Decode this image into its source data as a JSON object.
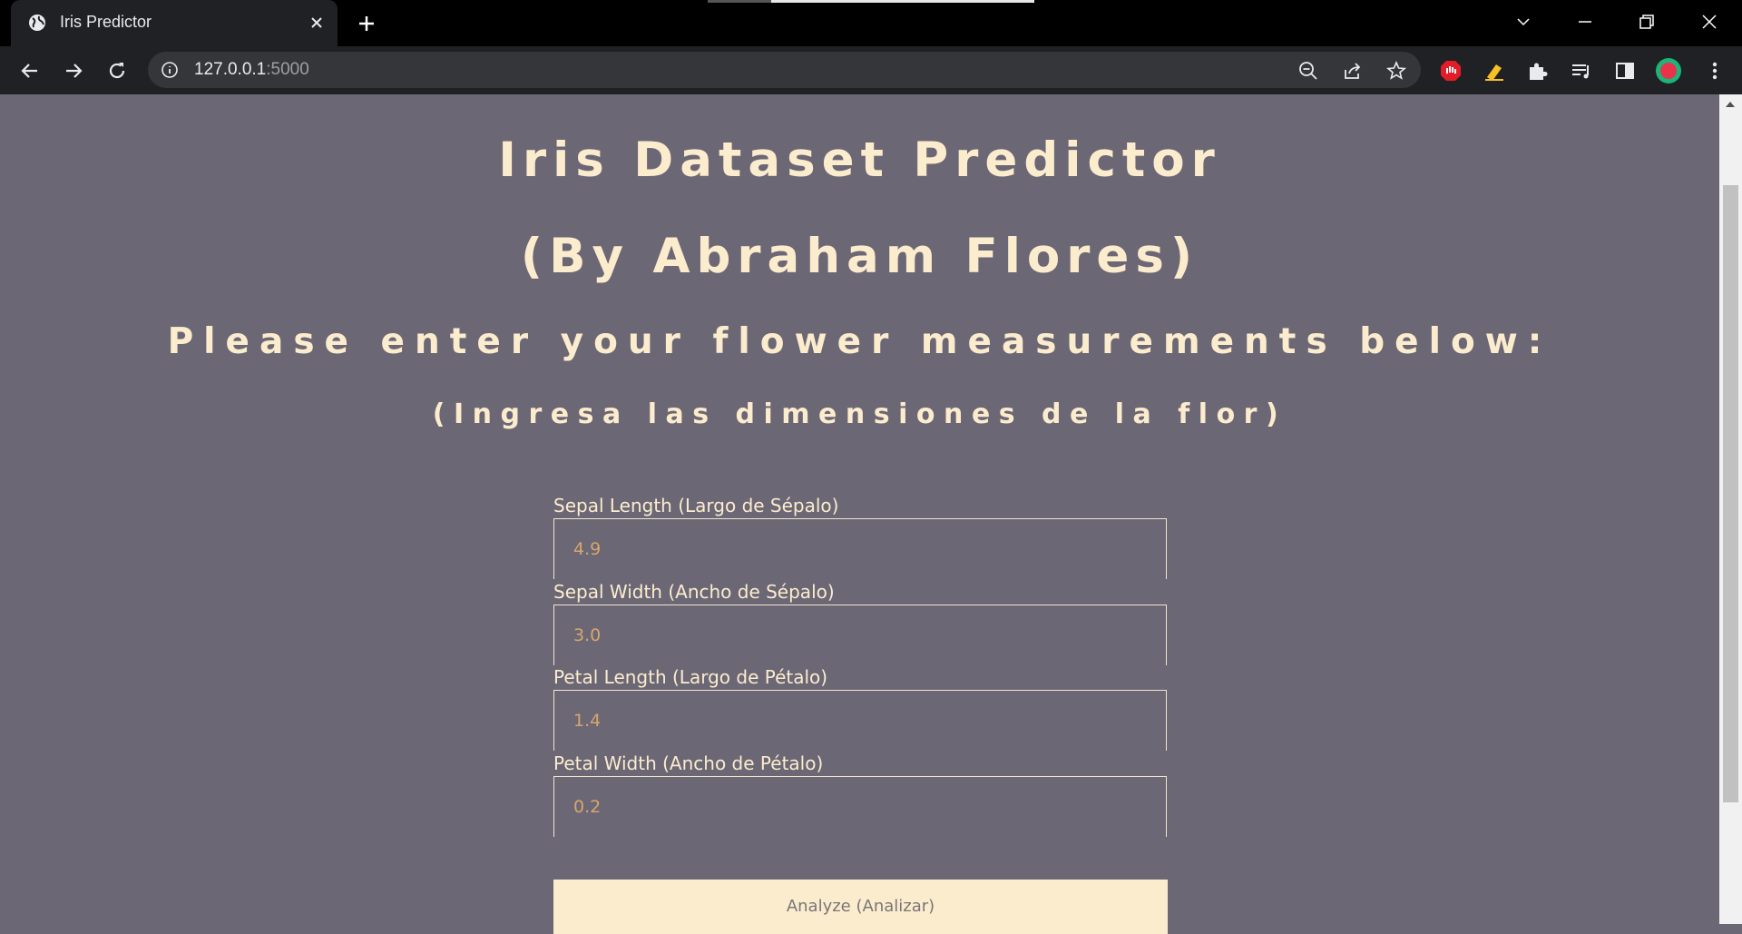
{
  "browser": {
    "tab_title": "Iris Predictor",
    "url_host": "127.0.0.1",
    "url_port": ":5000",
    "icons": {
      "favicon": "globe-icon",
      "close": "close-icon",
      "new_tab": "plus-icon",
      "back": "arrow-left-icon",
      "forward": "arrow-right-icon",
      "reload": "reload-icon",
      "info": "info-icon",
      "zoom": "zoom-out-icon",
      "share": "share-icon",
      "bookmark": "star-icon",
      "extensions": [
        "adblock-icon",
        "highlighter-icon",
        "puzzle-icon",
        "media-control-icon",
        "side-panel-icon"
      ],
      "menu": "kebab-icon"
    }
  },
  "page": {
    "title_line1": "Iris Dataset Predictor",
    "title_line2": "(By Abraham Flores)",
    "subtitle": "Please enter your flower measurements below:",
    "subtitle_es": "(Ingresa las dimensiones de la flor)",
    "fields": [
      {
        "label": "Sepal Length (Largo de Sépalo)",
        "placeholder": "4.9"
      },
      {
        "label": "Sepal Width (Ancho de Sépalo)",
        "placeholder": "3.0"
      },
      {
        "label": "Petal Length (Largo de Pétalo)",
        "placeholder": "1.4"
      },
      {
        "label": "Petal Width (Ancho de Pétalo)",
        "placeholder": "0.2"
      }
    ],
    "submit_label": "Analyze (Analizar)"
  },
  "colors": {
    "page_bg": "#6b6775",
    "heading": "#fcecce",
    "input_text": "#d7a66e",
    "button_bg": "#fcecce"
  }
}
